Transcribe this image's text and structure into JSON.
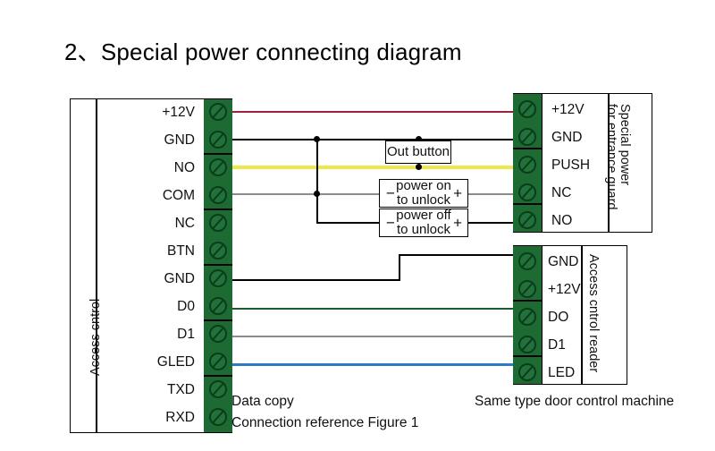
{
  "title": "2、Special power connecting diagram",
  "left_unit": {
    "caption": "Access  cntrol",
    "pins": [
      "+12V",
      "GND",
      "NO",
      "COM",
      "NC",
      "BTN",
      "GND",
      "D0",
      "D1",
      "GLED",
      "TXD",
      "RXD"
    ]
  },
  "right_power_unit": {
    "caption_line1": "Special power",
    "caption_line2": "for entrance guard",
    "pins": [
      "+12V",
      "GND",
      "PUSH",
      "NC",
      "NO"
    ]
  },
  "right_reader_unit": {
    "caption": "Access cntrol reader",
    "pins": [
      "GND",
      "+12V",
      "DO",
      "D1",
      "LED"
    ]
  },
  "components": {
    "out_button": {
      "label": "Out button"
    },
    "lock_power_on": {
      "line1": "power on",
      "line2": "to unlock",
      "minus": "−",
      "plus": "+"
    },
    "lock_power_off": {
      "line1": "power off",
      "line2": "to unlock",
      "minus": "−",
      "plus": "+"
    }
  },
  "captions": {
    "data_copy": "Data copy",
    "connection_reference": "Connection reference Figure 1",
    "same_type": "Same type door control machine"
  },
  "wire_colors": {
    "power_positive": "#9e2233",
    "ground": "#000000",
    "push_signal": "#efe74a",
    "common": "#8c8c8c",
    "d0": "#1a5c2a",
    "d1": "#8c8c8c",
    "gled": "#2e7ac4",
    "terminal_body": "#1d6b33"
  }
}
